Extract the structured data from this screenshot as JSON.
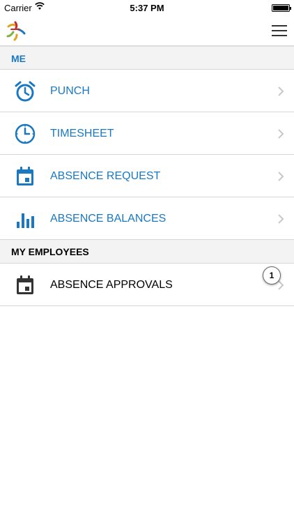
{
  "status_bar": {
    "carrier": "Carrier",
    "time": "5:37 PM",
    "wifi_icon": "wifi-icon",
    "battery_icon": "battery-icon"
  },
  "nav_bar": {
    "logo_icon": "app-logo-icon",
    "menu_icon": "hamburger-menu-icon"
  },
  "sections": {
    "me": {
      "title": "ME",
      "items": [
        {
          "label": "PUNCH",
          "icon": "alarm-clock-icon"
        },
        {
          "label": "TIMESHEET",
          "icon": "clock-icon"
        },
        {
          "label": "ABSENCE REQUEST",
          "icon": "calendar-icon"
        },
        {
          "label": "ABSENCE BALANCES",
          "icon": "bar-chart-icon"
        }
      ]
    },
    "my_employees": {
      "title": "MY EMPLOYEES",
      "items": [
        {
          "label": "ABSENCE APPROVALS",
          "icon": "calendar-icon",
          "badge": "1"
        }
      ]
    }
  },
  "colors": {
    "accent": "#1a78c2",
    "header_bg": "#f3f3f3",
    "divider": "#d6d6d6"
  }
}
